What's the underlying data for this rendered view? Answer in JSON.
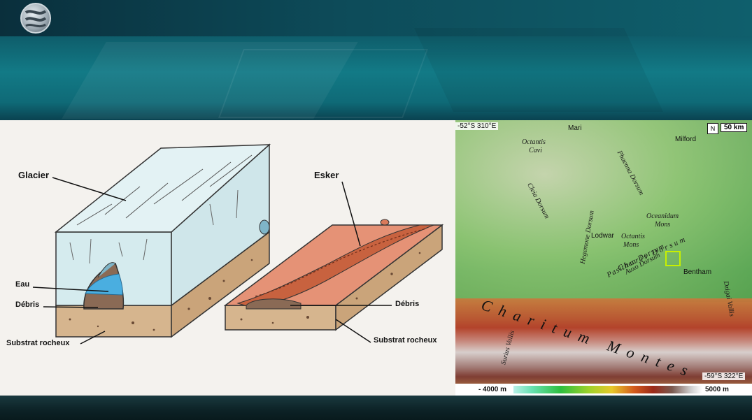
{
  "diagram": {
    "labels": {
      "glacier": "Glacier",
      "eau": "Eau",
      "debris_left": "Débris",
      "substrat_left": "Substrat rocheux",
      "esker": "Esker",
      "debris_right": "Débris",
      "substrat_right": "Substrat rocheux"
    },
    "colors": {
      "ice": "#d5ebee",
      "water": "#4aaee0",
      "esker": "#d97a5a",
      "soil": "#d6b58e"
    }
  },
  "map": {
    "corner_nw": "-52°S 310°E",
    "corner_se": "-59°S 322°E",
    "scale": "50 km",
    "north_symbol": "N",
    "legend_min": "- 4000 m",
    "legend_max": "5000 m",
    "places": {
      "mari": "Mari",
      "milford": "Milford",
      "lodwar": "Lodwar",
      "bentham": "Bentham"
    },
    "features": {
      "octantis_cavi_1": "Octantis",
      "octantis_cavi_2": "Cavi",
      "cleia_dorsum": "Cleia Dorsum",
      "phaenna_dorsum": "Phaenna Dorsum",
      "hegemone_dorsum": "Hegemone Dorsum",
      "oceanidum_mons_1": "Oceanidum",
      "oceanidum_mons_2": "Mons",
      "octantis_mons_1": "Octantis",
      "octantis_mons_2": "Mons",
      "pasithea_dorsum": "Pasithea Dorsum",
      "auxo_dorsum": "Auxo Dorsum",
      "charis_dorsum": "Charis Dorsum",
      "charitum_montes": "Charitum Montes",
      "surius_vallis": "Surius Vallis",
      "dzigai_vallis": "Dzigai Vallis"
    }
  }
}
